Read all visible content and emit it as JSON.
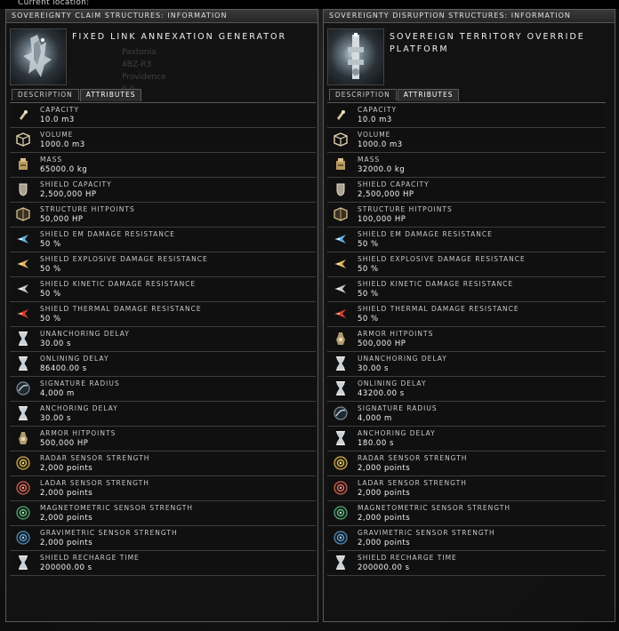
{
  "top": {
    "location_label": "Current location:"
  },
  "left": {
    "title": "SOVEREIGNTY CLAIM STRUCTURES: INFORMATION",
    "item_name": "FIXED LINK ANNEXATION GENERATOR",
    "ghost_lines": [
      "Paxtonia",
      "4BZ-R3",
      "Providence",
      "0.0"
    ],
    "tabs": [
      "DESCRIPTION",
      "ATTRIBUTES"
    ],
    "active_tab": "ATTRIBUTES",
    "attributes": [
      {
        "label": "CAPACITY",
        "value": "10.0 m3",
        "icon": "capacity-icon"
      },
      {
        "label": "VOLUME",
        "value": "1000.0 m3",
        "icon": "volume-icon"
      },
      {
        "label": "MASS",
        "value": "65000.0 kg",
        "icon": "mass-icon"
      },
      {
        "label": "SHIELD CAPACITY",
        "value": "2,500,000 HP",
        "icon": "shield-icon"
      },
      {
        "label": "STRUCTURE HITPOINTS",
        "value": "50,000 HP",
        "icon": "structure-icon"
      },
      {
        "label": "SHIELD EM DAMAGE RESISTANCE",
        "value": "50 %",
        "icon": "em-damage-icon"
      },
      {
        "label": "SHIELD EXPLOSIVE DAMAGE RESISTANCE",
        "value": "50 %",
        "icon": "explosive-damage-icon"
      },
      {
        "label": "SHIELD KINETIC DAMAGE RESISTANCE",
        "value": "50 %",
        "icon": "kinetic-damage-icon"
      },
      {
        "label": "SHIELD THERMAL DAMAGE RESISTANCE",
        "value": "50 %",
        "icon": "thermal-damage-icon"
      },
      {
        "label": "UNANCHORING DELAY",
        "value": "30.00 s",
        "icon": "hourglass-icon"
      },
      {
        "label": "ONLINING DELAY",
        "value": "86400.00 s",
        "icon": "hourglass-icon"
      },
      {
        "label": "SIGNATURE RADIUS",
        "value": "4,000 m",
        "icon": "signature-radius-icon"
      },
      {
        "label": "ANCHORING DELAY",
        "value": "30.00 s",
        "icon": "hourglass-icon"
      },
      {
        "label": "ARMOR HITPOINTS",
        "value": "500,000 HP",
        "icon": "armor-icon"
      },
      {
        "label": "RADAR SENSOR STRENGTH",
        "value": "2,000 points",
        "icon": "radar-sensor-icon"
      },
      {
        "label": "LADAR SENSOR STRENGTH",
        "value": "2,000 points",
        "icon": "ladar-sensor-icon"
      },
      {
        "label": "MAGNETOMETRIC SENSOR STRENGTH",
        "value": "2,000 points",
        "icon": "magnetometric-sensor-icon"
      },
      {
        "label": "GRAVIMETRIC SENSOR STRENGTH",
        "value": "2,000 points",
        "icon": "gravimetric-sensor-icon"
      },
      {
        "label": "SHIELD RECHARGE TIME",
        "value": "200000.00 s",
        "icon": "hourglass-icon"
      }
    ]
  },
  "right": {
    "title": "SOVEREIGNTY DISRUPTION STRUCTURES: INFORMATION",
    "item_name": "SOVEREIGN TERRITORY OVERRIDE PLATFORM",
    "tabs": [
      "DESCRIPTION",
      "ATTRIBUTES"
    ],
    "active_tab": "ATTRIBUTES",
    "attributes": [
      {
        "label": "CAPACITY",
        "value": "10.0 m3",
        "icon": "capacity-icon"
      },
      {
        "label": "VOLUME",
        "value": "1000.0 m3",
        "icon": "volume-icon"
      },
      {
        "label": "MASS",
        "value": "32000.0 kg",
        "icon": "mass-icon"
      },
      {
        "label": "SHIELD CAPACITY",
        "value": "2,500,000 HP",
        "icon": "shield-icon"
      },
      {
        "label": "STRUCTURE HITPOINTS",
        "value": "100,000 HP",
        "icon": "structure-icon"
      },
      {
        "label": "SHIELD EM DAMAGE RESISTANCE",
        "value": "50 %",
        "icon": "em-damage-icon"
      },
      {
        "label": "SHIELD EXPLOSIVE DAMAGE RESISTANCE",
        "value": "50 %",
        "icon": "explosive-damage-icon"
      },
      {
        "label": "SHIELD KINETIC DAMAGE RESISTANCE",
        "value": "50 %",
        "icon": "kinetic-damage-icon"
      },
      {
        "label": "SHIELD THERMAL DAMAGE RESISTANCE",
        "value": "50 %",
        "icon": "thermal-damage-icon"
      },
      {
        "label": "ARMOR HITPOINTS",
        "value": "500,000 HP",
        "icon": "armor-icon"
      },
      {
        "label": "UNANCHORING DELAY",
        "value": "30.00 s",
        "icon": "hourglass-icon"
      },
      {
        "label": "ONLINING DELAY",
        "value": "43200.00 s",
        "icon": "hourglass-icon"
      },
      {
        "label": "SIGNATURE RADIUS",
        "value": "4,000 m",
        "icon": "signature-radius-icon"
      },
      {
        "label": "ANCHORING DELAY",
        "value": "180.00 s",
        "icon": "hourglass-icon"
      },
      {
        "label": "RADAR SENSOR STRENGTH",
        "value": "2,000 points",
        "icon": "radar-sensor-icon"
      },
      {
        "label": "LADAR SENSOR STRENGTH",
        "value": "2,000 points",
        "icon": "ladar-sensor-icon"
      },
      {
        "label": "MAGNETOMETRIC SENSOR STRENGTH",
        "value": "2,000 points",
        "icon": "magnetometric-sensor-icon"
      },
      {
        "label": "GRAVIMETRIC SENSOR STRENGTH",
        "value": "2,000 points",
        "icon": "gravimetric-sensor-icon"
      },
      {
        "label": "SHIELD RECHARGE TIME",
        "value": "200000.00 s",
        "icon": "hourglass-icon"
      }
    ]
  }
}
